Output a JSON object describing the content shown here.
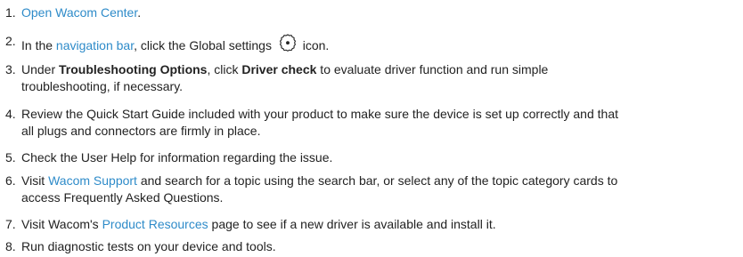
{
  "steps": [
    {
      "num": "1.",
      "link": "Open Wacom Center",
      "after": "."
    },
    {
      "num": "2.",
      "before": "In the ",
      "link": "navigation bar",
      "mid": ", click the Global settings ",
      "icon": "gear-icon",
      "after": " icon."
    },
    {
      "num": "3.",
      "before": "Under ",
      "bold1": "Troubleshooting Options",
      "mid": ", click ",
      "bold2": "Driver check",
      "after_line1": " to evaluate driver function and run simple",
      "line2": "troubleshooting, if necessary."
    },
    {
      "num": "4.",
      "line1": "Review the Quick Start Guide included with your product to make sure the device is set up correctly and that",
      "line2": "all plugs and connectors are firmly in place."
    },
    {
      "num": "5.",
      "text": "Check the User Help for information regarding the issue."
    },
    {
      "num": "6.",
      "before": "Visit ",
      "link": "Wacom Support",
      "after_line1": " and search for a topic using the search bar, or select any of the topic category cards to",
      "line2": "access Frequently Asked Questions."
    },
    {
      "num": "7.",
      "before": "Visit Wacom's ",
      "link": "Product Resources",
      "after": " page to see if a new driver is available and install it."
    },
    {
      "num": "8.",
      "text": "Run diagnostic tests on your device and tools."
    }
  ],
  "colors": {
    "link": "#2e8bc9",
    "text": "#222222"
  }
}
